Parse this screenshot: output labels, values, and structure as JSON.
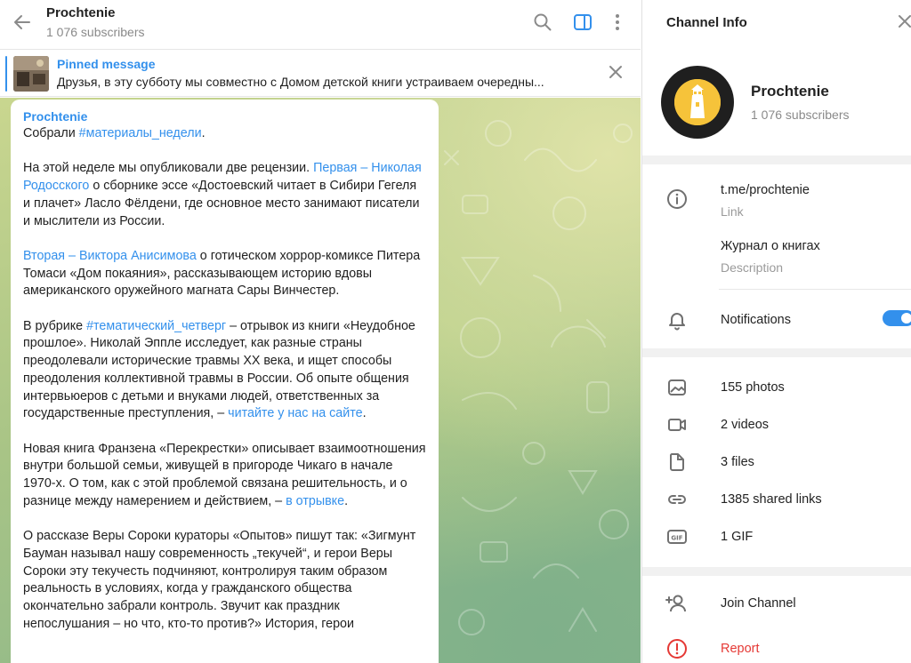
{
  "chat": {
    "title": "Prochtenie",
    "subscribers": "1 076 subscribers",
    "pinned": {
      "label": "Pinned message",
      "text": "Друзья, в эту субботу мы совместно с Домом детской книги устраиваем очередны..."
    },
    "message": {
      "author": "Prochtenie",
      "p1_a": "Собрали ",
      "p1_tag": "#материалы_недели",
      "p1_b": ".",
      "p2_a": "На этой неделе мы опубликовали две рецензии. ",
      "p2_link": "Первая – Николая Родосского",
      "p2_b": " о сборнике эссе «Достоевский читает в Сибири Гегеля и плачет» Ласло Фёлдени, где основное место занимают писатели и мыслители из России.",
      "p3_link": "Вторая – Виктора Анисимова",
      "p3_b": " о готическом хоррор-комиксе Питера Томаси «Дом покаяния», рассказывающем историю вдовы американского оружейного магната Сары Винчестер.",
      "p4_a": "В рубрике ",
      "p4_tag": "#тематический_четверг",
      "p4_b": " – отрывок из книги «Неудобное прошлое». Николай Эппле исследует, как разные страны преодолевали исторические травмы XX века, и ищет способы преодоления коллективной травмы в России. Об опыте общения интервьюеров с детьми и внуками людей, ответственных за государственные преступления, – ",
      "p4_link": "читайте у нас на сайте",
      "p4_c": ".",
      "p5_a": "Новая книга Франзена «Перекрестки» описывает взаимоотношения внутри большой семьи, живущей в пригороде Чикаго в начале 1970-х. О том, как с этой проблемой связана решительность, и о разнице между намерением и действием, – ",
      "p5_link": "в отрывке",
      "p5_b": ".",
      "p6_a": "О рассказе Веры Сороки кураторы «Опытов» пишут так: «Зигмунт Бауман называл нашу современность „текучей“, и герои Веры Сороки эту текучесть подчиняют, контролируя таким образом реальность в условиях, когда у гражданского общества окончательно забрали контроль. Звучит как праздник непослушания – но что, кто-то против?» История, герои"
    }
  },
  "info": {
    "title": "Channel Info",
    "name": "Prochtenie",
    "subscribers": "1 076 subscribers",
    "link": "t.me/prochtenie",
    "link_label": "Link",
    "description": "Журнал о книгах",
    "description_label": "Description",
    "notifications": "Notifications",
    "notifications_on": true,
    "media": {
      "photos": "155 photos",
      "videos": "2 videos",
      "files": "3 files",
      "links": "1385 shared links",
      "gifs": "1 GIF"
    },
    "join": "Join Channel",
    "report": "Report"
  },
  "colors": {
    "accent": "#3390ec",
    "danger": "#e53935",
    "muted_text": "#8a8a8a"
  },
  "icons": [
    "back-arrow-icon",
    "search-icon",
    "sidebar-toggle-icon",
    "more-vertical-icon",
    "close-icon",
    "info-icon",
    "bell-icon",
    "photo-icon",
    "video-icon",
    "file-icon",
    "link-icon",
    "gif-icon",
    "add-user-icon",
    "report-icon"
  ]
}
